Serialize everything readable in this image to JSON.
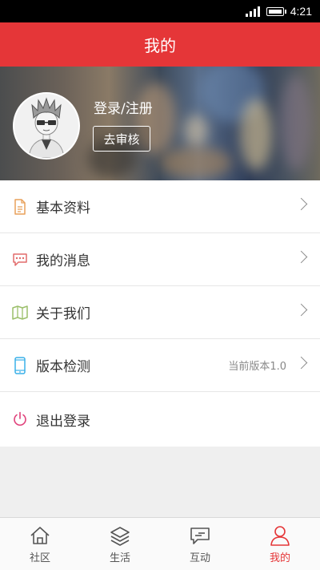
{
  "status_bar": {
    "time": "4:21"
  },
  "header": {
    "title": "我的"
  },
  "profile": {
    "login_text": "登录/注册",
    "review_button": "去审核"
  },
  "menu": {
    "items": [
      {
        "label": "基本资料",
        "icon": "document-icon",
        "right_text": ""
      },
      {
        "label": "我的消息",
        "icon": "message-icon",
        "right_text": ""
      },
      {
        "label": "关于我们",
        "icon": "map-icon",
        "right_text": ""
      },
      {
        "label": "版本检测",
        "icon": "phone-icon",
        "right_text": "当前版本1.0"
      },
      {
        "label": "退出登录",
        "icon": "power-icon",
        "right_text": ""
      }
    ]
  },
  "bottom_nav": {
    "items": [
      {
        "label": "社区",
        "icon": "home-icon"
      },
      {
        "label": "生活",
        "icon": "layers-icon"
      },
      {
        "label": "互动",
        "icon": "chat-icon"
      },
      {
        "label": "我的",
        "icon": "user-icon",
        "active": true
      }
    ]
  },
  "colors": {
    "brand_red": "#e53638",
    "icon_orange": "#e8a05a",
    "icon_red": "#e26b6b",
    "icon_green": "#9bbf6a",
    "icon_blue": "#3ab0e8",
    "icon_pink": "#e0407a"
  }
}
